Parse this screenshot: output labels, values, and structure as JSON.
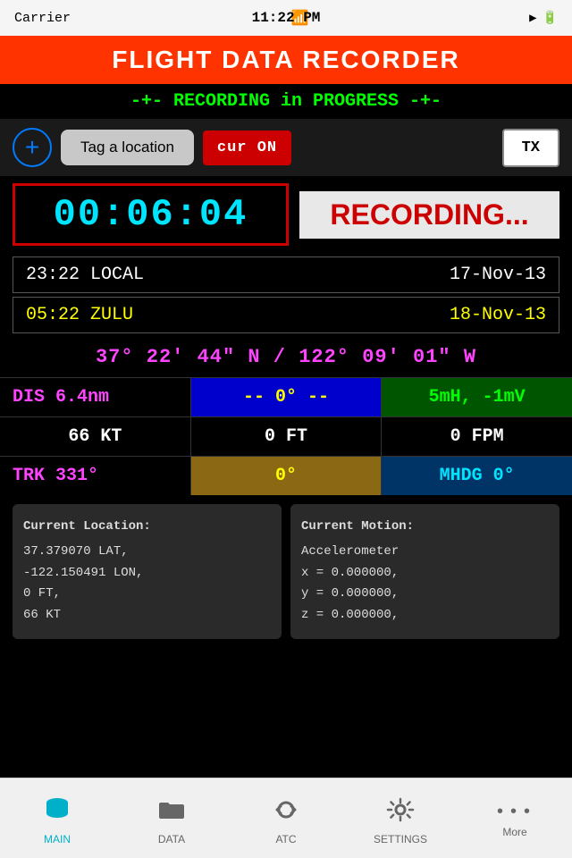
{
  "status_bar": {
    "carrier": "Carrier",
    "wifi": "WiFi",
    "time": "11:22 PM",
    "gps_arrow": "➤",
    "battery": "████"
  },
  "header": {
    "title": "FLIGHT DATA RECORDER"
  },
  "recording_status": {
    "text": "-+- RECORDING in PROGRESS -+-",
    "plus_color": "#00ff00",
    "text_color": "#00ff00"
  },
  "controls": {
    "add_icon": "+",
    "tag_label": "Tag a location",
    "cur_label": "cur ON",
    "tx_label": "TX"
  },
  "timer": {
    "value": "00:06:04",
    "recording_label": "RECORDING..."
  },
  "local_time": {
    "time": "23:22  LOCAL",
    "date": "17-Nov-13"
  },
  "zulu_time": {
    "time": "05:22  ZULU",
    "date": "18-Nov-13"
  },
  "coordinates": {
    "text": "37°  22'  44\"  N  /  122°  09'  01\"  W"
  },
  "data": {
    "dis": "DIS 6.4nm",
    "hdg": "-- 0° --",
    "signal": "5mH, -1mV",
    "speed": "66 KT",
    "altitude": "0 FT",
    "fpm": "0 FPM",
    "trk": "TRK 331°",
    "trk_val": "0°",
    "mhdg": "MHDG 0°"
  },
  "info_left": {
    "title": "Current Location:",
    "line1": "37.379070 LAT,",
    "line2": "-122.150491 LON,",
    "line3": "0 FT,",
    "line4": "66 KT"
  },
  "info_right": {
    "title": "Current Motion:",
    "line1": "Accelerometer",
    "line2": "x = 0.000000,",
    "line3": "y = 0.000000,",
    "line4": "z = 0.000000,"
  },
  "nav": {
    "items": [
      {
        "id": "main",
        "label": "MAIN",
        "active": true
      },
      {
        "id": "data",
        "label": "DATA",
        "active": false
      },
      {
        "id": "atc",
        "label": "ATC",
        "active": false
      },
      {
        "id": "settings",
        "label": "SETTINGS",
        "active": false
      },
      {
        "id": "more",
        "label": "More",
        "active": false
      }
    ]
  },
  "colors": {
    "accent_red": "#ff3300",
    "cyan": "#00e5ff",
    "yellow": "#ffff00",
    "magenta": "#ff44ff",
    "green": "#00ff00",
    "recording_red": "#cc0000"
  }
}
